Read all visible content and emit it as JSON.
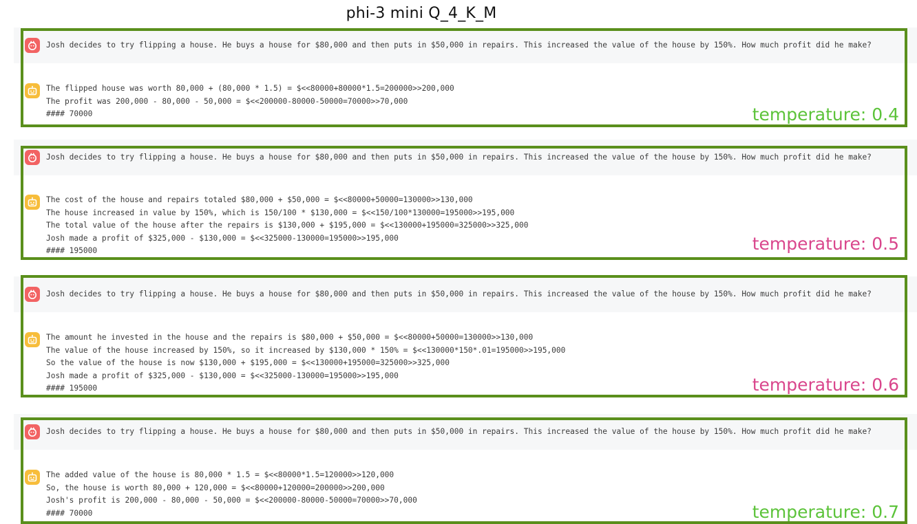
{
  "title": "phi-3 mini Q_4_K_M",
  "colors": {
    "frame": "#5a8f1c",
    "user_avatar": "#f26363",
    "bot_avatar": "#f7bd3b",
    "temp_green": "#5cc33a",
    "temp_pink": "#d9468c"
  },
  "panels": [
    {
      "question": "Josh decides to try flipping a house. He buys a house for $80,000 and then puts in $50,000 in repairs. This increased the value of the house by 150%. How much profit did he make?",
      "answer": [
        "The flipped house was worth 80,000 + (80,000 * 1.5) = $<<80000+80000*1.5=200000>>200,000",
        "The profit was 200,000 - 80,000 - 50,000 = $<<200000-80000-50000=70000>>70,000",
        "#### 70000"
      ],
      "temperature": "temperature: 0.4",
      "temp_color": "#5cc33a"
    },
    {
      "question": "Josh decides to try flipping a house. He buys a house for $80,000 and then puts in $50,000 in repairs. This increased the value of the house by 150%. How much profit did he make?",
      "answer": [
        "The cost of the house and repairs totaled $80,000 + $50,000 = $<<80000+50000=130000>>130,000",
        "The house increased in value by 150%, which is 150/100 * $130,000 = $<<150/100*130000=195000>>195,000",
        "The total value of the house after the repairs is $130,000 + $195,000 = $<<130000+195000=325000>>325,000",
        "Josh made a profit of $325,000 - $130,000 = $<<325000-130000=195000>>195,000",
        "#### 195000"
      ],
      "temperature": "temperature: 0.5",
      "temp_color": "#d9468c"
    },
    {
      "question": "Josh decides to try flipping a house. He buys a house for $80,000 and then puts in $50,000 in repairs. This increased the value of the house by 150%. How much profit did he make?",
      "answer": [
        "The amount he invested in the house and the repairs is $80,000 + $50,000 = $<<80000+50000=130000>>130,000",
        "The value of the house increased by 150%, so it increased by $130,000 * 150% = $<<130000*150*.01=195000>>195,000",
        "So the value of the house is now $130,000 + $195,000 = $<<130000+195000=325000>>325,000",
        "Josh made a profit of $325,000 - $130,000 = $<<325000-130000=195000>>195,000",
        "#### 195000"
      ],
      "temperature": "temperature: 0.6",
      "temp_color": "#d9468c"
    },
    {
      "question": "Josh decides to try flipping a house. He buys a house for $80,000 and then puts in $50,000 in repairs. This increased the value of the house by 150%. How much profit did he make?",
      "answer": [
        "The added value of the house is 80,000 * 1.5 = $<<80000*1.5=120000>>120,000",
        "So, the house is worth 80,000 + 120,000 = $<<80000+120000=200000>>200,000",
        "Josh's profit is 200,000 - 80,000 - 50,000 = $<<200000-80000-50000=70000>>70,000",
        "#### 70000"
      ],
      "temperature": "temperature: 0.7",
      "temp_color": "#5cc33a"
    }
  ]
}
